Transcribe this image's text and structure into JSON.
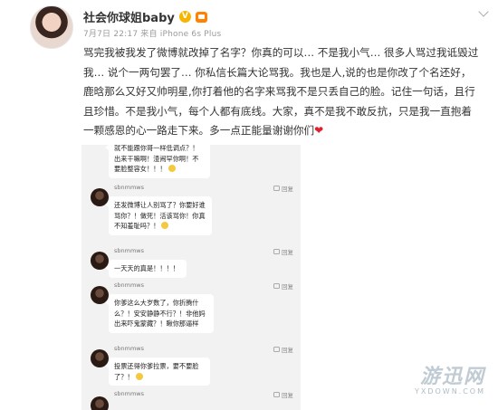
{
  "post": {
    "username": "社会你球姐baby",
    "verified_mark": "V",
    "meta": "7月7日 22:17 来自 iPhone 6s Plus",
    "body": "骂完我被我发了微博就改掉了名字？你真的可以… 不是我小气… 很多人骂过我诋毁过我… 说个一两句罢了… 你私信长篇大论骂我。我也是人,说的也是你改了个名还好，鹿晗那么又好又帅明星,你打着他的名字来骂我不是只丢自己的脸。记住一句话，且行且珍惜。不是我小气，每个人都有底线。大家，真不是我不敢反抗，只是我一直抱着一颗感恩的心一路走下来。多一点正能量谢谢你们",
    "heart": "❤"
  },
  "comments": [
    {
      "user": "",
      "text": "就不能跟你哥一样低调点？！出来干嘛啊！渣闹罕你啊！不要脸整容女！！！",
      "reply": ""
    },
    {
      "user": "sbnmmws",
      "text": "还发微博让人别骂了？你要好谁骂你？！做死！活该骂你！你真不知羞耻吗？！",
      "reply": "回复"
    },
    {
      "user": "sbnmmws",
      "text": "一天天的真是！！！！",
      "reply": "回复"
    },
    {
      "user": "sbnmmws",
      "text": "你爹这么大岁数了，你折腾什么？！安安静静不行？！非他妈出来吓鬼蒙藏？！瞅你那逼样",
      "reply": "回复"
    },
    {
      "user": "sbnmmws",
      "text": "投票还得你爹拉票，要不要脸了？！",
      "reply": "回复"
    },
    {
      "user": "sbnmmws",
      "text": "",
      "reply": "回复"
    }
  ],
  "watermark": {
    "logo": "游迅网",
    "domain": "YXDOWN.COM"
  }
}
